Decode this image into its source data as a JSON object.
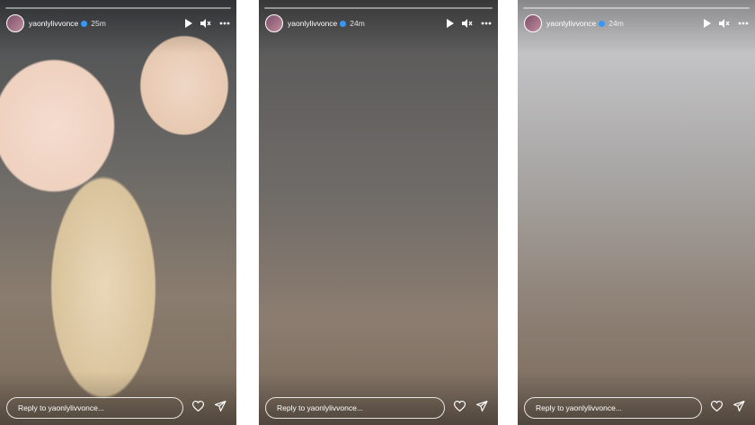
{
  "stories": [
    {
      "username": "yaonlylivvonce",
      "time": "25m",
      "reply_placeholder": "Reply to yaonlylivvonce..."
    },
    {
      "username": "yaonlylivvonce",
      "time": "24m",
      "reply_placeholder": "Reply to yaonlylivvonce..."
    },
    {
      "username": "yaonlylivvonce",
      "time": "24m",
      "reply_placeholder": "Reply to yaonlylivvonce..."
    }
  ],
  "icons": {
    "verified": "verified-badge-icon",
    "play": "play-icon",
    "mute": "speaker-muted-icon",
    "more": "more-dots-icon",
    "like": "heart-icon",
    "share": "paper-plane-icon"
  },
  "colors": {
    "verified": "#3897f0",
    "ui_text": "#ffffff",
    "gutter": "#ffffff"
  }
}
